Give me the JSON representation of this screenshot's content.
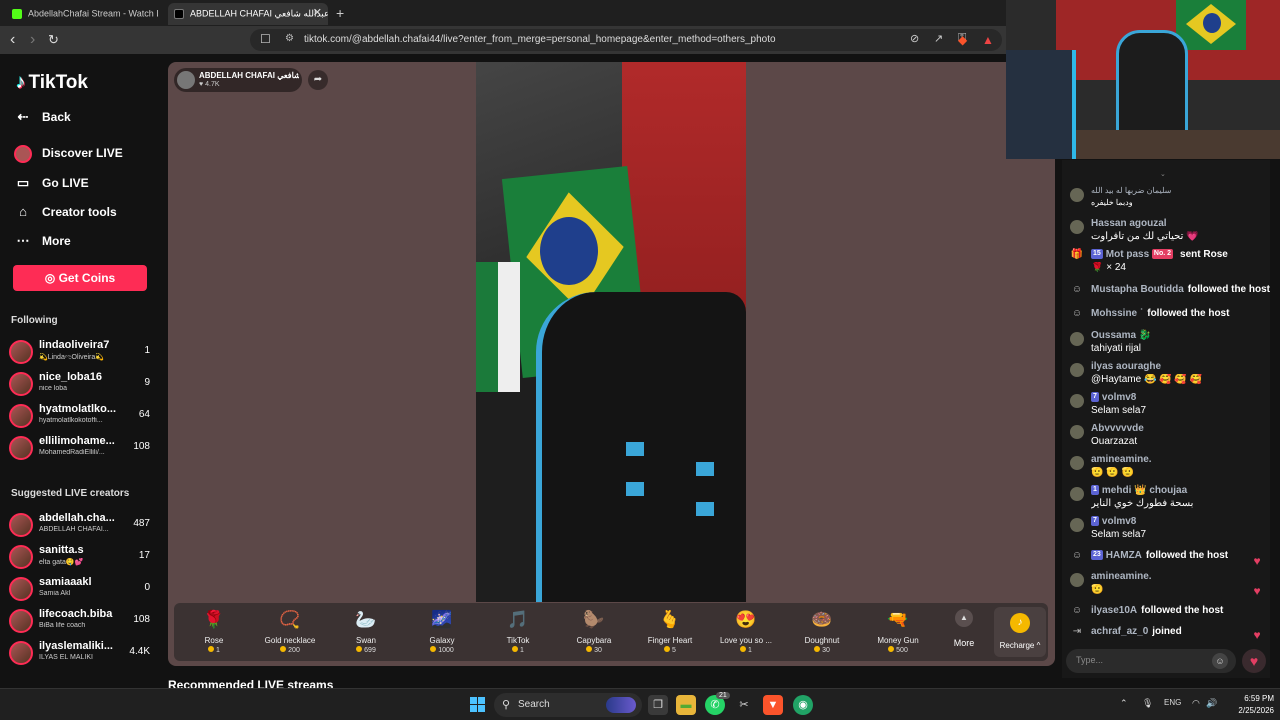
{
  "browser": {
    "tabs": [
      {
        "title": "AbdellahChafai Stream - Watch Live o"
      },
      {
        "title": "ABDELLAH CHAFAI عبدالله شافعي"
      }
    ],
    "url": "tiktok.com/@abdellah.chafai44/live?enter_from_merge=personal_homepage&enter_method=others_photo"
  },
  "sidebar": {
    "logo": "TikTok",
    "nav": [
      {
        "label": "Back",
        "icon": "back-arrow-icon"
      },
      {
        "label": "Discover LIVE",
        "icon": "live-avatar-icon"
      },
      {
        "label": "Go LIVE",
        "icon": "video-camera-icon"
      },
      {
        "label": "Creator tools",
        "icon": "lightbulb-icon"
      },
      {
        "label": "More",
        "icon": "ellipsis-icon"
      }
    ],
    "get_coins": "Get Coins",
    "following_title": "Following",
    "following": [
      {
        "name": "lindaoliveira7",
        "sub": "💫LindaಌOliveira💫",
        "count": "1"
      },
      {
        "name": "nice_loba16",
        "sub": "nice loba",
        "count": "9"
      },
      {
        "name": "hyatmolatlko...",
        "sub": "hyatmolatlkokotoffi...",
        "count": "64"
      },
      {
        "name": "ellilimohame...",
        "sub": "MohamedRadiEllili/...",
        "count": "108"
      }
    ],
    "suggested_title": "Suggested LIVE creators",
    "suggested": [
      {
        "name": "abdellah.cha...",
        "sub": "ABDELLAH CHAFAI...",
        "count": "487"
      },
      {
        "name": "sanitta.s",
        "sub": "elta gata🤤💕",
        "count": "17"
      },
      {
        "name": "samiaaakl",
        "sub": "Samia Akl",
        "count": "0"
      },
      {
        "name": "lifecoach.biba",
        "sub": "BiBa life coach",
        "count": "108"
      },
      {
        "name": "ilyaslemaliki...",
        "sub": "ILYAS EL MALIKI",
        "count": "4.4K"
      }
    ]
  },
  "live": {
    "host_name": "ABDELLAH CHAFAI عبدالله شافعي",
    "likes": "4.7K",
    "gifts": [
      {
        "name": "Rose",
        "price": "1",
        "emoji": "🌹"
      },
      {
        "name": "Gold necklace",
        "price": "200",
        "emoji": "📿"
      },
      {
        "name": "Swan",
        "price": "699",
        "emoji": "🦢"
      },
      {
        "name": "Galaxy",
        "price": "1000",
        "emoji": "🌌"
      },
      {
        "name": "TikTok",
        "price": "1",
        "emoji": "🎵"
      },
      {
        "name": "Capybara",
        "price": "30",
        "emoji": "🦫"
      },
      {
        "name": "Finger Heart",
        "price": "5",
        "emoji": "🫰"
      },
      {
        "name": "Love you so ...",
        "price": "1",
        "emoji": "😍"
      },
      {
        "name": "Doughnut",
        "price": "30",
        "emoji": "🍩"
      },
      {
        "name": "Money Gun",
        "price": "500",
        "emoji": "🔫"
      }
    ],
    "more_label": "More",
    "recharge_label": "Recharge ^",
    "recommended_title": "Recommended LIVE streams"
  },
  "chat": {
    "messages": [
      {
        "user": "سليمان ضربها له بيد الله",
        "text": "ودبما خليفره",
        "type": "comment"
      },
      {
        "user": "Hassan agouzal",
        "text": "تحياتي لك من تافراوت 💗",
        "type": "comment"
      },
      {
        "user": "Mot pass",
        "text": "sent Rose",
        "extra": "🌹 × 24",
        "badge": "15",
        "badge2": "No. 2",
        "type": "gift"
      },
      {
        "user": "Mustapha Boutidda",
        "text": "followed the host",
        "type": "follow"
      },
      {
        "user": "Mohssine ˙",
        "text": "followed the host",
        "type": "follow"
      },
      {
        "user": "Oussama 🐉",
        "text": "tahiyati rijal",
        "type": "comment"
      },
      {
        "user": "ilyas aouraghe",
        "text": "@Haytame 😂 🥰 🥰 🥰",
        "type": "comment"
      },
      {
        "user": "volmv8",
        "text": "Selam sela7",
        "badge": "7",
        "type": "comment"
      },
      {
        "user": "Abvvvvvde",
        "text": "Ouarzazat",
        "type": "comment"
      },
      {
        "user": "amineamine.",
        "text": "🫡 🫡 🫡",
        "type": "comment"
      },
      {
        "user": "mehdi 👑 choujaa",
        "text": "بسحة فطورك خوي الناير",
        "badge": "1",
        "type": "comment"
      },
      {
        "user": "volmv8",
        "text": "Selam sela7",
        "badge": "7",
        "type": "comment"
      },
      {
        "user": "HAMZA",
        "text": "followed the host",
        "badge": "23",
        "type": "follow"
      },
      {
        "user": "amineamine.",
        "text": "🫡",
        "type": "comment"
      },
      {
        "user": "ilyase10A",
        "text": "followed the host",
        "type": "follow"
      },
      {
        "user": "achraf_az_0",
        "text": "joined",
        "type": "join"
      }
    ],
    "input_placeholder": "Type..."
  },
  "taskbar": {
    "search_label": "Search",
    "whatsapp_badge": "21",
    "language": "ENG",
    "time": "6:59 PM",
    "date": "2/25/2026"
  },
  "colors": {
    "accent": "#fe2c55",
    "stage_bg": "#5c4848",
    "coin": "#f5b800"
  }
}
